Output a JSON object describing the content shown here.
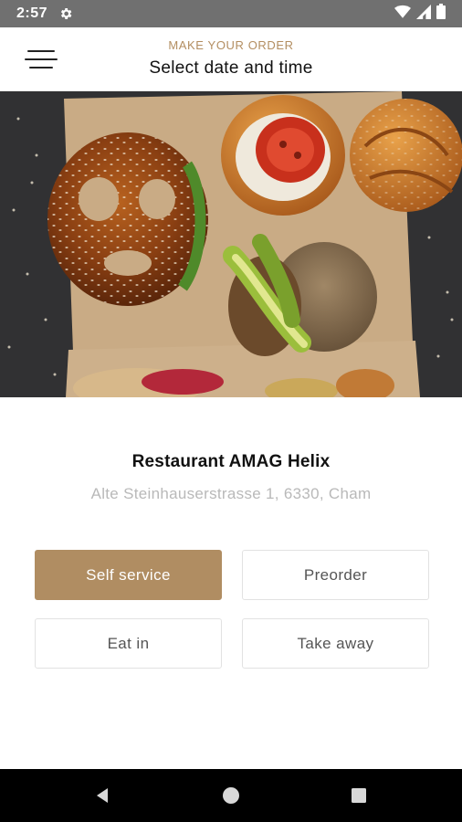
{
  "status_bar": {
    "time": "2:57",
    "icons": [
      "settings-icon",
      "wifi-icon",
      "signal-icon",
      "battery-icon"
    ]
  },
  "app_bar": {
    "kicker": "MAKE YOUR ORDER",
    "title": "Select date and time",
    "menu_icon": "hamburger-menu-icon"
  },
  "hero": {
    "image": "food-photo-pretzel-sandwiches"
  },
  "restaurant": {
    "name": "Restaurant AMAG Helix",
    "address": "Alte Steinhauserstrasse 1, 6330, Cham"
  },
  "service_options": {
    "self_service": "Self service",
    "preorder": "Preorder",
    "eat_in": "Eat in",
    "take_away": "Take away",
    "selected": "Self service"
  },
  "nav_bar": {
    "icons": [
      "back-icon",
      "home-icon",
      "recents-icon"
    ]
  },
  "colors": {
    "accent": "#b08d62",
    "status_bar": "#707070",
    "nav_bar": "#000000"
  }
}
